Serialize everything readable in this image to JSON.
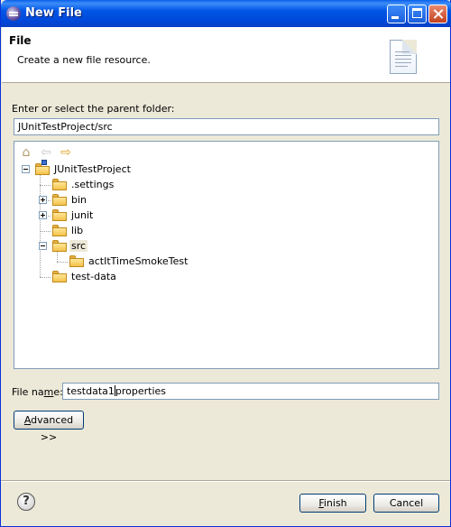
{
  "window": {
    "title": "New File"
  },
  "banner": {
    "title": "File",
    "message": "Create a new file resource."
  },
  "parent_folder": {
    "label": "Enter or select the parent folder:",
    "value": "JUnitTestProject/src"
  },
  "tree": {
    "toolbar": [
      {
        "icon": "home-icon"
      },
      {
        "icon": "back-arrow-icon"
      },
      {
        "icon": "forward-arrow-icon"
      }
    ],
    "nodes": [
      {
        "label": "JUnitTestProject",
        "expander": "minus",
        "icon": "project-folder-icon"
      },
      {
        "label": ".settings",
        "expander": "none",
        "icon": "folder-icon"
      },
      {
        "label": "bin",
        "expander": "plus",
        "icon": "folder-icon"
      },
      {
        "label": "junit",
        "expander": "plus",
        "icon": "folder-icon"
      },
      {
        "label": "lib",
        "expander": "none",
        "icon": "folder-icon"
      },
      {
        "label": "src",
        "expander": "minus",
        "icon": "folder-icon",
        "selected": true
      },
      {
        "label": "actItTimeSmokeTest",
        "expander": "none",
        "icon": "folder-icon"
      },
      {
        "label": "test-data",
        "expander": "none",
        "icon": "folder-icon"
      }
    ]
  },
  "file_name": {
    "label_pre": "File na",
    "label_mnemonic": "m",
    "label_post": "e:",
    "value_before_caret": "testdata1",
    "value_after_caret": "properties"
  },
  "buttons": {
    "advanced": {
      "mnemonic": "A",
      "rest": "dvanced >>"
    },
    "finish": {
      "mnemonic": "F",
      "rest": "inish"
    },
    "cancel": {
      "label": "Cancel"
    },
    "help": {
      "label": "?"
    }
  }
}
